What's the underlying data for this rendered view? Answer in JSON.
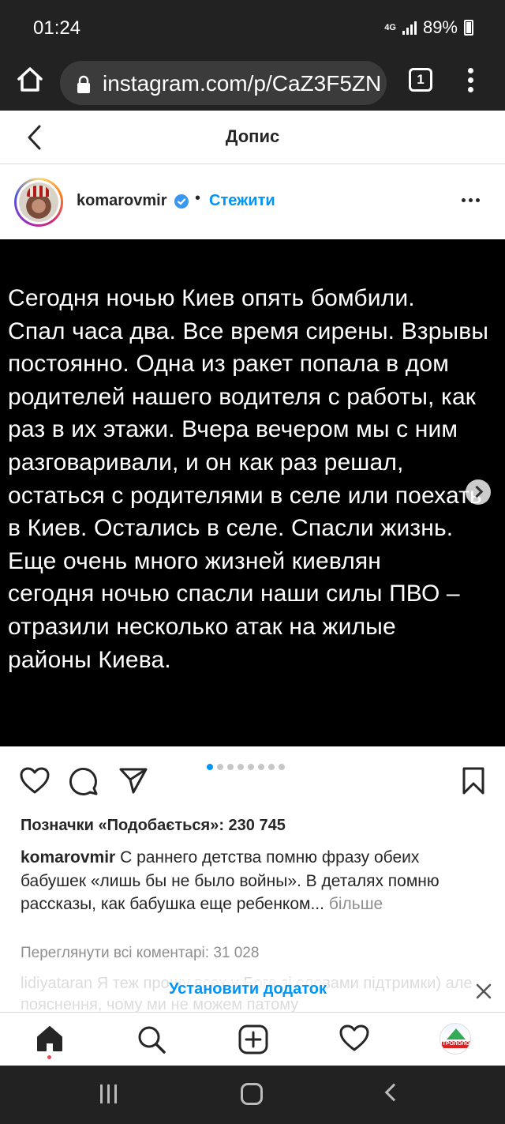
{
  "status_bar": {
    "time": "01:24",
    "network": "4G",
    "battery": "89%"
  },
  "browser": {
    "url": "instagram.com/p/CaZ3F5ZN",
    "tab_count": "1"
  },
  "header": {
    "title": "Допис"
  },
  "post": {
    "username": "komarovmir",
    "bullet": "•",
    "follow_label": "Стежити",
    "image_text_lines": [
      "Сегодня ночью Киев опять бомбили.",
      "Спал часа два. Все время сирены. Взрывы",
      "постоянно. Одна из ракет попала в дом",
      "родителей нашего водителя с работы, как",
      "раз в их этажи. Вчера вечером мы с ним",
      "разговаривали, и он как раз решал,",
      "остаться с родителями в селе или поехать",
      "в Киев. Остались в селе. Спасли жизнь.",
      "Еще очень много жизней киевлян",
      "сегодня ночью спасли наши силы ПВО –",
      "отразили несколько атак на жилые",
      "районы Киева."
    ],
    "carousel_count": 8,
    "carousel_active": 0,
    "likes": "Позначки «Подобається»: 230 745",
    "caption_username": "komarovmir",
    "caption_text": "С раннего детства помню фразу обеих бабушек «лишь бы не было войны». В деталях помню рассказы, как бабушка еще ребенком...",
    "caption_more": "більше",
    "view_comments": "Переглянути всі коментарі: 31 028",
    "faded_comment": "lidiyataran Я теж прошу всех у Бога зі словами підтримки) але пояснення, чому ми не можем патому"
  },
  "install_banner": {
    "label": "Установити додаток"
  },
  "bottom_nav": {
    "profile_avatar_text": "ТРОЛОЛО"
  },
  "icons": {
    "home": "home-icon",
    "search": "search-icon",
    "new_post": "new-post-icon",
    "activity": "heart-icon",
    "like": "heart-icon",
    "comment": "comment-icon",
    "share": "send-icon",
    "save": "bookmark-icon"
  },
  "colors": {
    "link_blue": "#0095f6",
    "dark_chrome": "#222222",
    "text": "#262626",
    "muted": "#8e8e8e"
  }
}
